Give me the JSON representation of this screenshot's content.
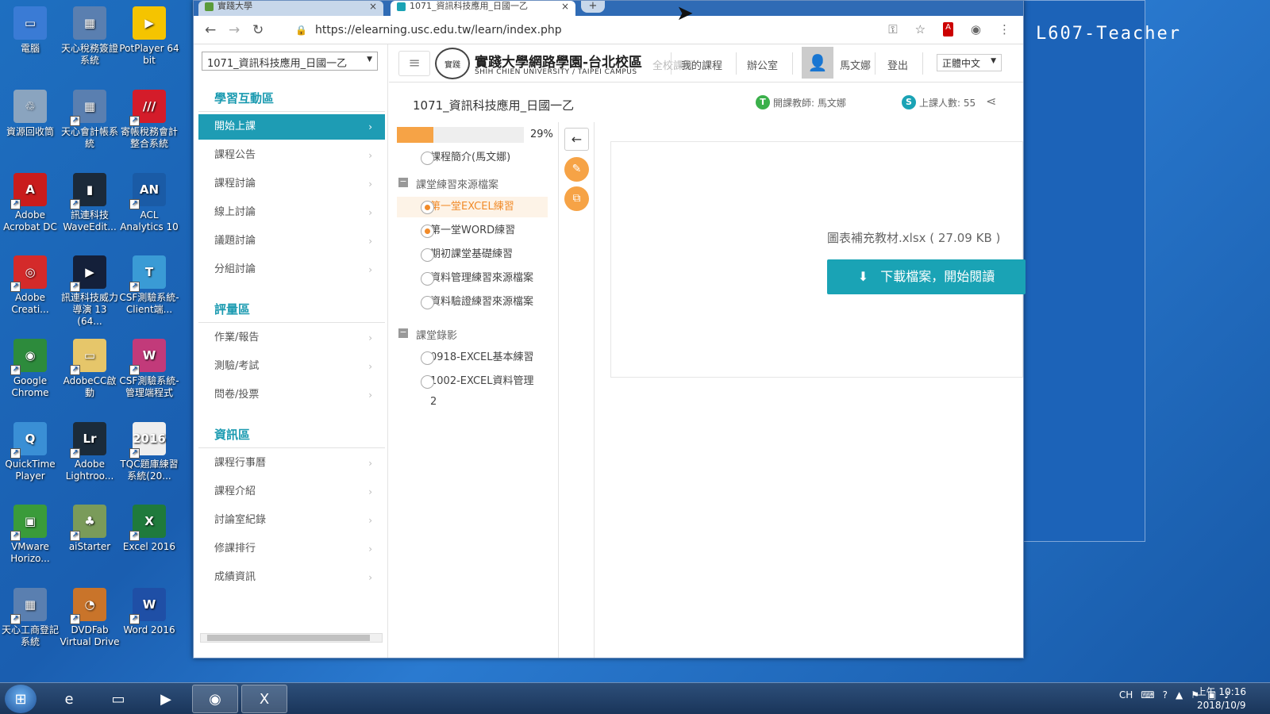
{
  "desktop": {
    "teacher_label": "L607-Teacher",
    "icons": [
      {
        "label": "電腦",
        "name": "computer-icon",
        "color": "#3a7bd5",
        "glyph": "▭"
      },
      {
        "label": "天心稅務簽證系統",
        "name": "tianxin-tax-icon",
        "color": "#5a7fb0",
        "glyph": "▦"
      },
      {
        "label": "PotPlayer 64 bit",
        "name": "potplayer-icon",
        "color": "#f5c400",
        "glyph": "▶"
      },
      {
        "label": "資源回收筒",
        "name": "recycle-bin-icon",
        "color": "#8aa4bf",
        "glyph": "♲"
      },
      {
        "label": "天心會計帳系統",
        "name": "tianxin-account-icon",
        "color": "#5a7fb0",
        "glyph": "▦"
      },
      {
        "label": "寄帳稅務會計整合系統",
        "name": "tax-integration-icon",
        "color": "#d41c2a",
        "glyph": "///"
      },
      {
        "label": "Adobe Acrobat DC",
        "name": "acrobat-icon",
        "color": "#c91c1c",
        "glyph": "A"
      },
      {
        "label": "訊連科技 WaveEdit...",
        "name": "waveedit-icon",
        "color": "#1b2a3a",
        "glyph": "▮"
      },
      {
        "label": "ACL Analytics 10",
        "name": "acl-analytics-icon",
        "color": "#1a5ba6",
        "glyph": "AN"
      },
      {
        "label": "Adobe Creati...",
        "name": "adobe-creative-icon",
        "color": "#d42a2a",
        "glyph": "◎"
      },
      {
        "label": "訊連科技威力導演 13 (64...",
        "name": "powerdirector-icon",
        "color": "#14203a",
        "glyph": "▶"
      },
      {
        "label": "CSF測驗系統-Client端...",
        "name": "csf-client-icon",
        "color": "#3a9bd5",
        "glyph": "T"
      },
      {
        "label": "Google Chrome",
        "name": "chrome-desktop-icon",
        "color": "#2d8b3c",
        "glyph": "◉"
      },
      {
        "label": "AdobeCC啟動",
        "name": "adobecc-folder-icon",
        "color": "#e6c66a",
        "glyph": "▭"
      },
      {
        "label": "CSF測驗系統-管理端程式",
        "name": "csf-admin-icon",
        "color": "#c23a7a",
        "glyph": "W"
      },
      {
        "label": "QuickTime Player",
        "name": "quicktime-icon",
        "color": "#3a8fd5",
        "glyph": "Q"
      },
      {
        "label": "Adobe Lightroo...",
        "name": "lightroom-icon",
        "color": "#1b2b3a",
        "glyph": "Lr"
      },
      {
        "label": "TQC題庫練習系統(20...",
        "name": "tqc-icon",
        "color": "#eeeeee",
        "glyph": "2016"
      },
      {
        "label": "VMware Horizo...",
        "name": "vmware-icon",
        "color": "#3a9b3a",
        "glyph": "▣"
      },
      {
        "label": "aiStarter",
        "name": "aistarter-icon",
        "color": "#7a9b5a",
        "glyph": "♣"
      },
      {
        "label": "Excel 2016",
        "name": "excel-desktop-icon",
        "color": "#1f7a3c",
        "glyph": "X"
      },
      {
        "label": "天心工商登記系統",
        "name": "tianxin-business-icon",
        "color": "#5a7fb0",
        "glyph": "▦"
      },
      {
        "label": "DVDFab Virtual Drive",
        "name": "dvdfab-icon",
        "color": "#c9742a",
        "glyph": "◔"
      },
      {
        "label": "Word 2016",
        "name": "word-desktop-icon",
        "color": "#1f4fa6",
        "glyph": "W"
      }
    ]
  },
  "taskbar": {
    "tray": "CH",
    "time": "上午 10:16",
    "date": "2018/10/9"
  },
  "browser": {
    "tabs": [
      {
        "title": "實踐大學"
      },
      {
        "title": "1071_資訊科技應用_日國一乙"
      }
    ],
    "url": "https://elearning.usc.edu.tw/learn/index.php"
  },
  "site": {
    "title": "實踐大學網路學園-台北校區",
    "subtitle": "SHIH CHIEN UNIVERSITY / TAIPEI CAMPUS",
    "nav": [
      "全校課程",
      "我的課程",
      "辦公室"
    ],
    "user": "馬文娜",
    "logout": "登出",
    "language": "正體中文"
  },
  "sidebar": {
    "course_select": "1071_資訊科技應用_日國一乙",
    "sections": [
      {
        "title": "學習互動區",
        "items": [
          "開始上課",
          "課程公告",
          "課程討論",
          "線上討論",
          "議題討論",
          "分組討論"
        ]
      },
      {
        "title": "評量區",
        "items": [
          "作業/報告",
          "測驗/考試",
          "問卷/投票"
        ]
      },
      {
        "title": "資訊區",
        "items": [
          "課程行事曆",
          "課程介紹",
          "討論室紀錄",
          "修課排行",
          "成績資訊"
        ]
      }
    ],
    "active_item": "開始上課"
  },
  "course": {
    "name": "1071_資訊科技應用_日國一乙",
    "teacher": "開課教師: 馬文娜",
    "students": "上課人數: 55"
  },
  "outline": {
    "progress": 29,
    "progress_label": "29%",
    "intro": "課程簡介(馬文娜)",
    "groups": [
      {
        "title": "課堂練習來源檔案",
        "items": [
          "第一堂EXCEL練習",
          "第一堂WORD練習",
          "期初課堂基礎練習",
          "資料管理練習來源檔案",
          "資料驗證練習來源檔案"
        ]
      },
      {
        "title": "課堂錄影",
        "items": [
          "0918-EXCEL基本練習",
          "1002-EXCEL資料管理",
          "2"
        ]
      }
    ]
  },
  "content": {
    "file_name": "圖表補充教材.xlsx ( 27.09 KB )",
    "download_label": "下載檔案，開始閱讀"
  },
  "colors": {
    "accent": "#1aa3b5",
    "progress": "#f6a346"
  }
}
